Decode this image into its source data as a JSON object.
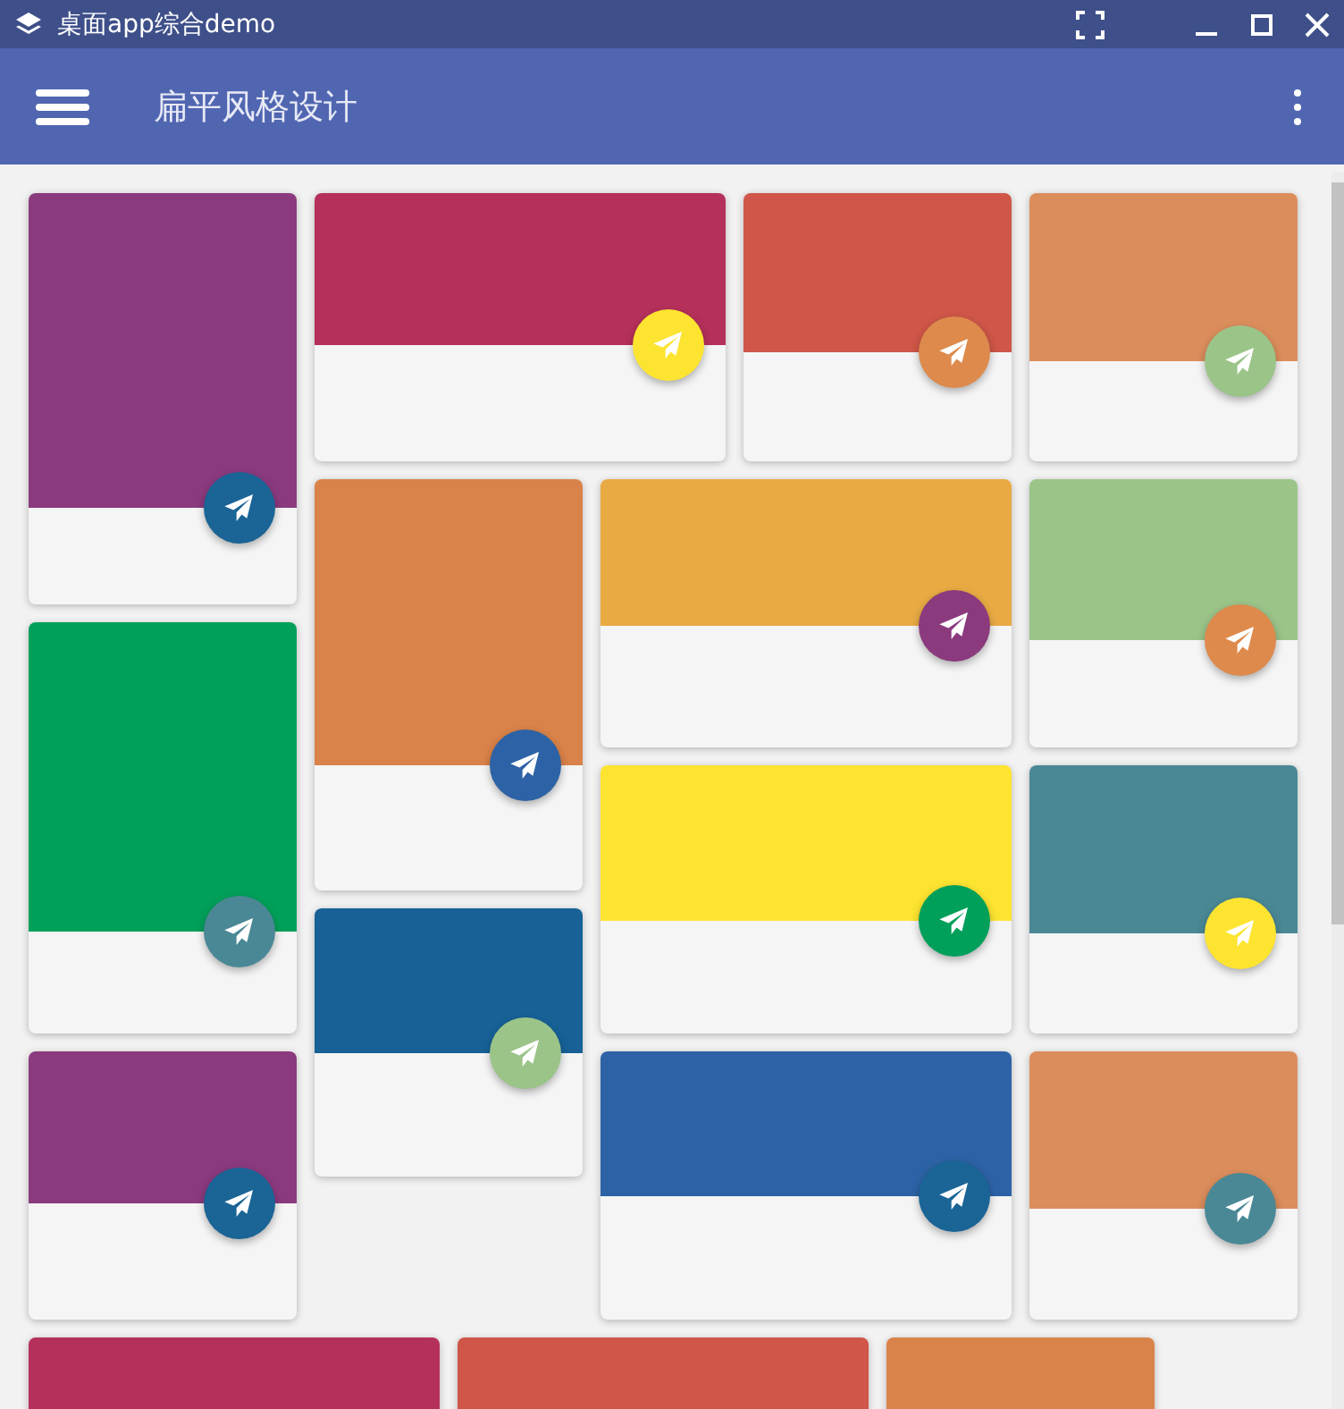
{
  "window": {
    "title": "桌面app综合demo"
  },
  "app_bar": {
    "title": "扁平风格设计"
  },
  "tiles": [
    {
      "color": "#8b3a7e",
      "button": {
        "color": "#1a6496"
      }
    },
    {
      "color": "#b5305a",
      "button": {
        "color": "#fde431"
      }
    },
    {
      "color": "#cf5648",
      "button": {
        "color": "#dd8a4c"
      }
    },
    {
      "color": "#dc8d5c",
      "button": {
        "color": "#9bc489"
      }
    },
    {
      "color": "#d98249",
      "button": {
        "color": "#2d63a6"
      }
    },
    {
      "color": "#e9aa43",
      "button": {
        "color": "#8b3a7e"
      }
    },
    {
      "color": "#9bc489",
      "button": {
        "color": "#dd8a4c"
      }
    },
    {
      "color": "#00a05a",
      "button": {
        "color": "#4a8896"
      }
    },
    {
      "color": "#fde431",
      "button": {
        "color": "#00a05a"
      }
    },
    {
      "color": "#4a8896",
      "button": {
        "color": "#fde431"
      }
    },
    {
      "color": "#176197",
      "button": {
        "color": "#9bc489"
      }
    },
    {
      "color": "#8b3a7e",
      "button": {
        "color": "#1a6496"
      }
    },
    {
      "color": "#2d63a6",
      "button": {
        "color": "#1a6496"
      }
    },
    {
      "color": "#dc8d5c",
      "button": {
        "color": "#4a8896"
      }
    },
    {
      "color": "#b5305a"
    },
    {
      "color": "#cf5648"
    },
    {
      "color": "#d98249"
    }
  ]
}
